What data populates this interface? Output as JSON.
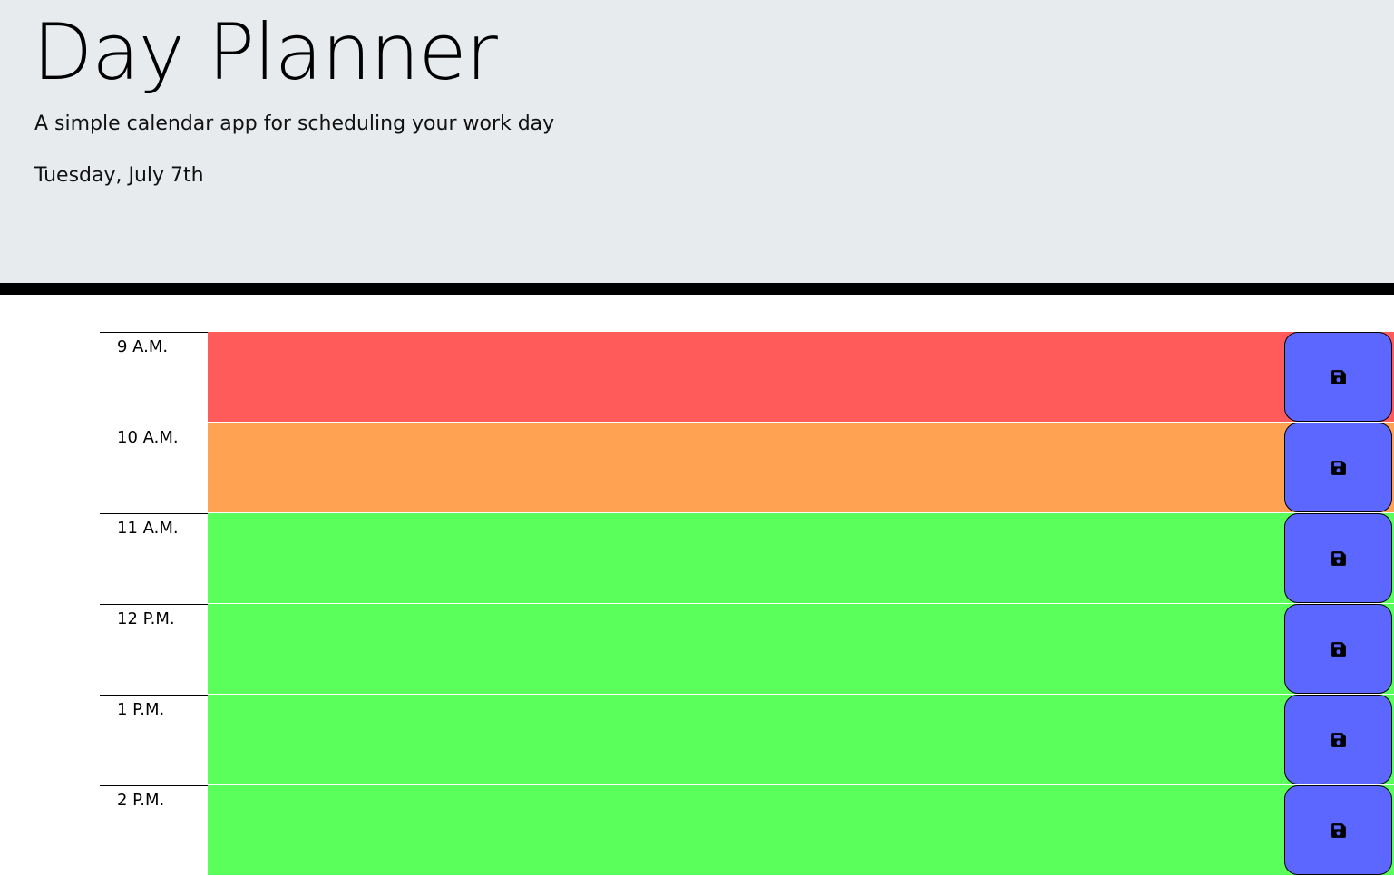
{
  "header": {
    "title": "Day Planner",
    "subtitle": "A simple calendar app for scheduling your work day",
    "current_day": "Tuesday, July 7th"
  },
  "colors": {
    "past": "#ff5b5b",
    "present": "#ffa352",
    "future": "#5bff5b",
    "save_button": "#5b67ff",
    "header_bg": "#e8ebee"
  },
  "timeblocks": [
    {
      "hour": "9 A.M.",
      "state": "past",
      "description": "",
      "icon": "save-icon"
    },
    {
      "hour": "10 A.M.",
      "state": "present",
      "description": "",
      "icon": "save-icon"
    },
    {
      "hour": "11 A.M.",
      "state": "future",
      "description": "",
      "icon": "save-icon"
    },
    {
      "hour": "12 P.M.",
      "state": "future",
      "description": "",
      "icon": "save-icon"
    },
    {
      "hour": "1 P.M.",
      "state": "future",
      "description": "",
      "icon": "save-icon"
    },
    {
      "hour": "2 P.M.",
      "state": "future",
      "description": "",
      "icon": "save-icon"
    }
  ]
}
